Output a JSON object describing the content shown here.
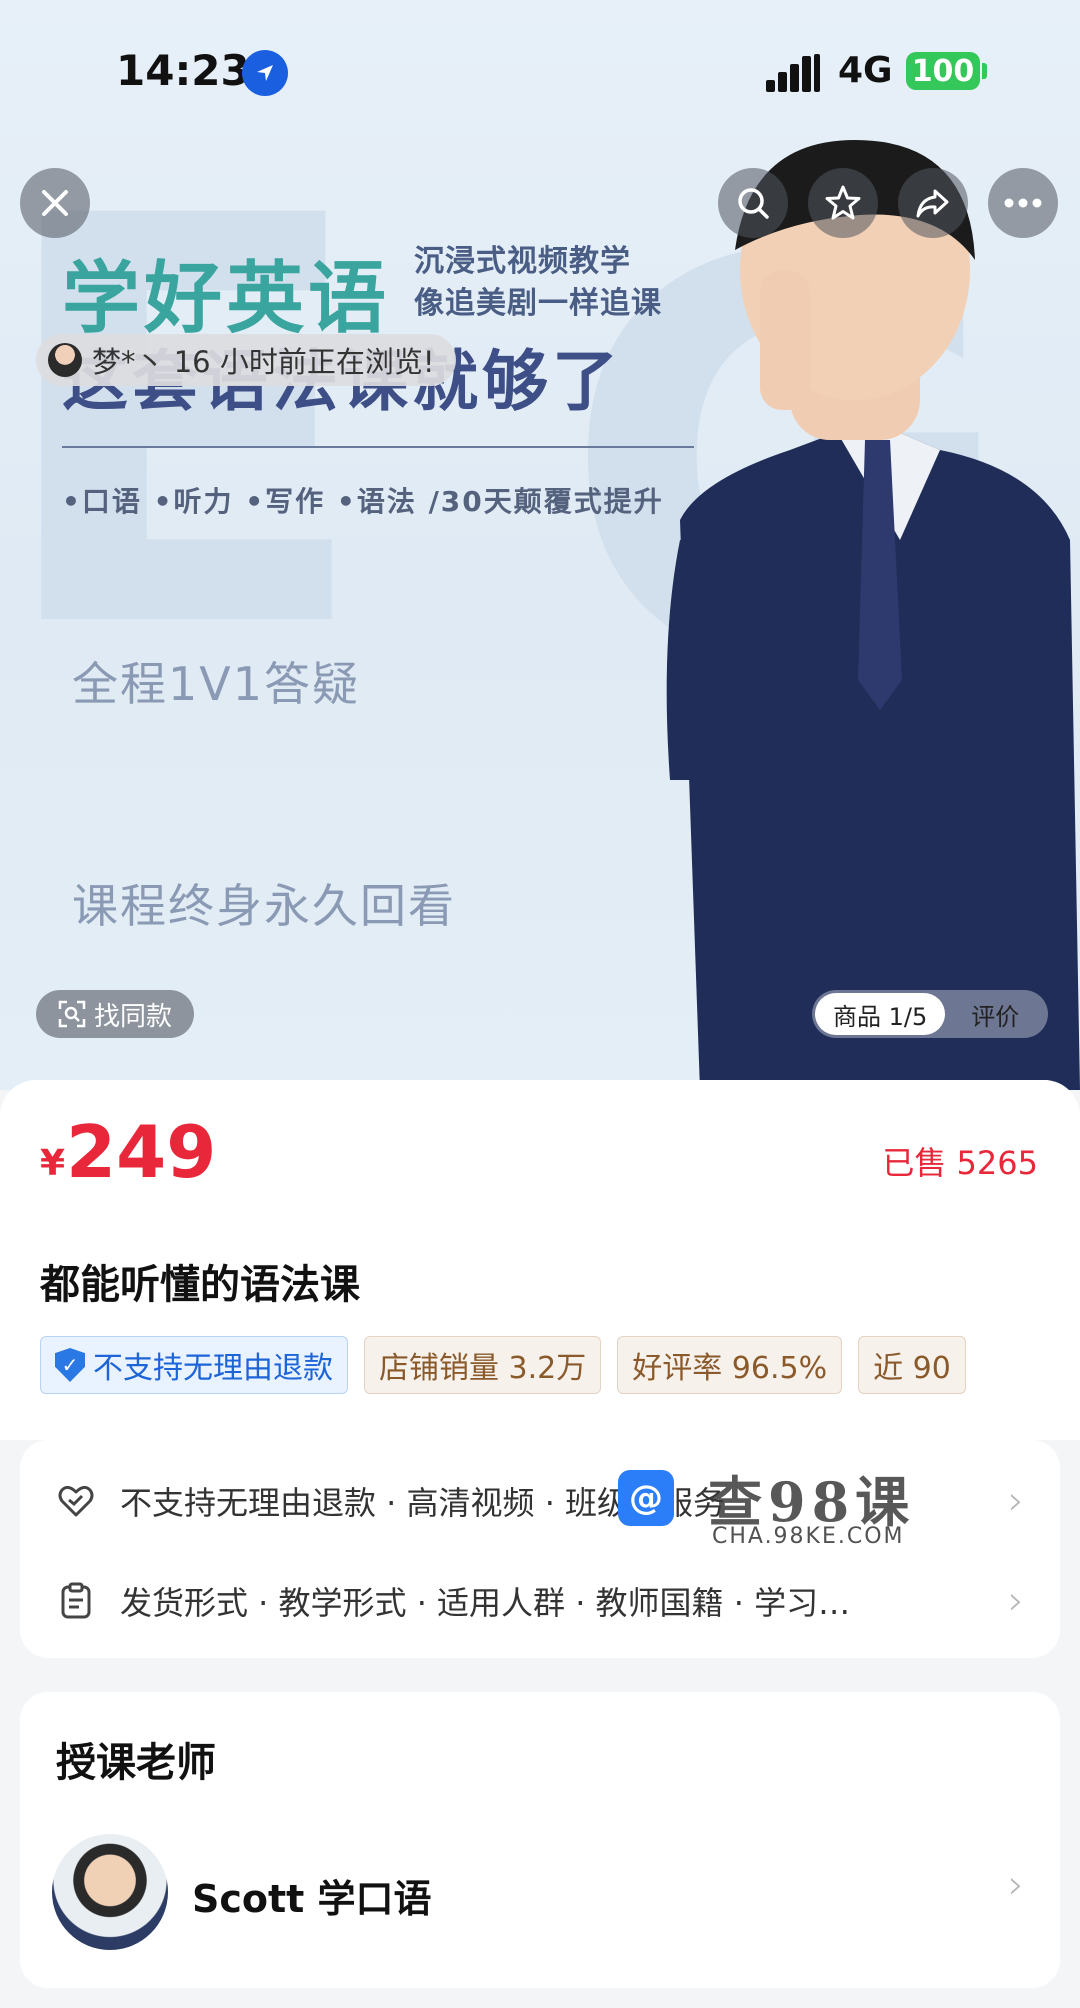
{
  "status_bar": {
    "time": "14:23",
    "network": "4G",
    "battery": "100"
  },
  "poster": {
    "title_line1": "学好英语",
    "subtitle_line1": "沉浸式视频教学",
    "subtitle_line2": "像追美剧一样追课",
    "title_line2": "这套语法课就够了",
    "bullets": "•口语 •听力 •写作 •语法 /30天颠覆式提升",
    "feature1": "全程1V1答疑",
    "feature2": "课程终身永久回看"
  },
  "viewer_notice": {
    "text": "梦*丶 16 小时前正在浏览!"
  },
  "find_same": {
    "label": "找同款"
  },
  "media_tabs": {
    "active": "商品 1/5",
    "other": "评价"
  },
  "product": {
    "currency": "¥",
    "price": "249",
    "sold": "已售 5265",
    "title": "都能听懂的语法课",
    "tags": [
      "不支持无理由退款",
      "店铺销量 3.2万",
      "好评率 96.5%",
      "近 90"
    ]
  },
  "info_rows": {
    "service": "不支持无理由退款 · 高清视频 · 班级群服务",
    "details": "发货形式 · 教学形式 · 适用人群 · 教师国籍 · 学习…"
  },
  "watermark": {
    "logo": "@",
    "main": "查98课",
    "sub": "CHA.98KE.COM"
  },
  "teacher": {
    "section_title": "授课老师",
    "name": "Scott 学口语"
  },
  "colors": {
    "price_red": "#e8283a",
    "tag_blue": "#1c64d8",
    "battery_green": "#34c759"
  }
}
